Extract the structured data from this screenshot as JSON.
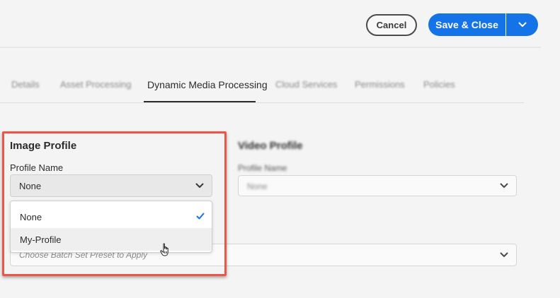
{
  "header": {
    "cancel_label": "Cancel",
    "save_label": "Save & Close"
  },
  "tabs": [
    {
      "label": "Details",
      "active": false
    },
    {
      "label": "Asset Processing",
      "active": false
    },
    {
      "label": "Dynamic Media Processing",
      "active": true
    },
    {
      "label": "Cloud Services",
      "active": false
    },
    {
      "label": "Permissions",
      "active": false
    },
    {
      "label": "Policies",
      "active": false
    }
  ],
  "image_profile": {
    "title": "Image Profile",
    "field_label": "Profile Name",
    "selected_value": "None",
    "options": [
      {
        "label": "None",
        "checked": true
      },
      {
        "label": "My-Profile",
        "checked": false
      }
    ]
  },
  "video_profile": {
    "title": "Video Profile",
    "field_label": "Profile Name",
    "selected_value": "None"
  },
  "batch_set": {
    "placeholder": "Choose Batch Set Preset to Apply"
  },
  "colors": {
    "accent": "#1473e6",
    "highlight": "#e9574a"
  }
}
